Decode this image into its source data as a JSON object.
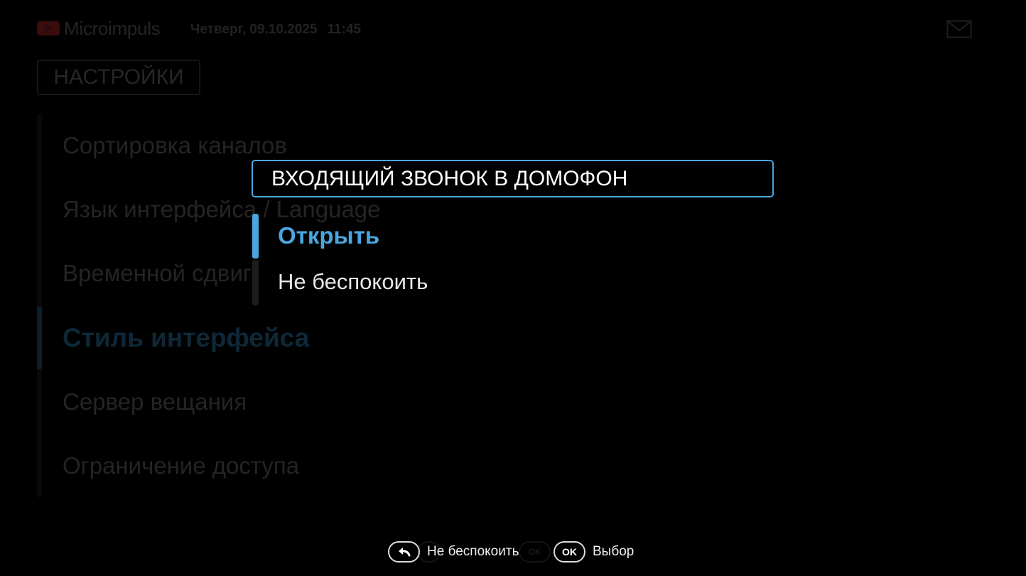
{
  "header": {
    "brand": "Microimpuls",
    "date": "Четверг, 09.10.2025",
    "time": "11:45",
    "logo_icon": "play-logo-icon",
    "mail_icon": "mail-icon"
  },
  "settings": {
    "title": "НАСТРОЙКИ",
    "items": [
      {
        "label": "Сортировка каналов"
      },
      {
        "label": "Язык интерфейса / Language"
      },
      {
        "label": "Временной сдвиг"
      },
      {
        "label": "Стиль интерфейса",
        "active": true
      },
      {
        "label": "Сервер вещания"
      },
      {
        "label": "Ограничение доступа"
      }
    ]
  },
  "dialog": {
    "title": "ВХОДЯЩИЙ ЗВОНОК В ДОМОФОН",
    "options": [
      {
        "label": "Открыть",
        "selected": true
      },
      {
        "label": "Не беспокоить",
        "selected": false
      }
    ]
  },
  "hints": {
    "back": {
      "icon": "back-arrow-icon",
      "label": "Не беспокоить"
    },
    "ok": {
      "key": "OK",
      "label": "Выбор"
    },
    "ghost_ok": "OK"
  },
  "colors": {
    "accent": "#4aa6df",
    "background": "#000000"
  }
}
